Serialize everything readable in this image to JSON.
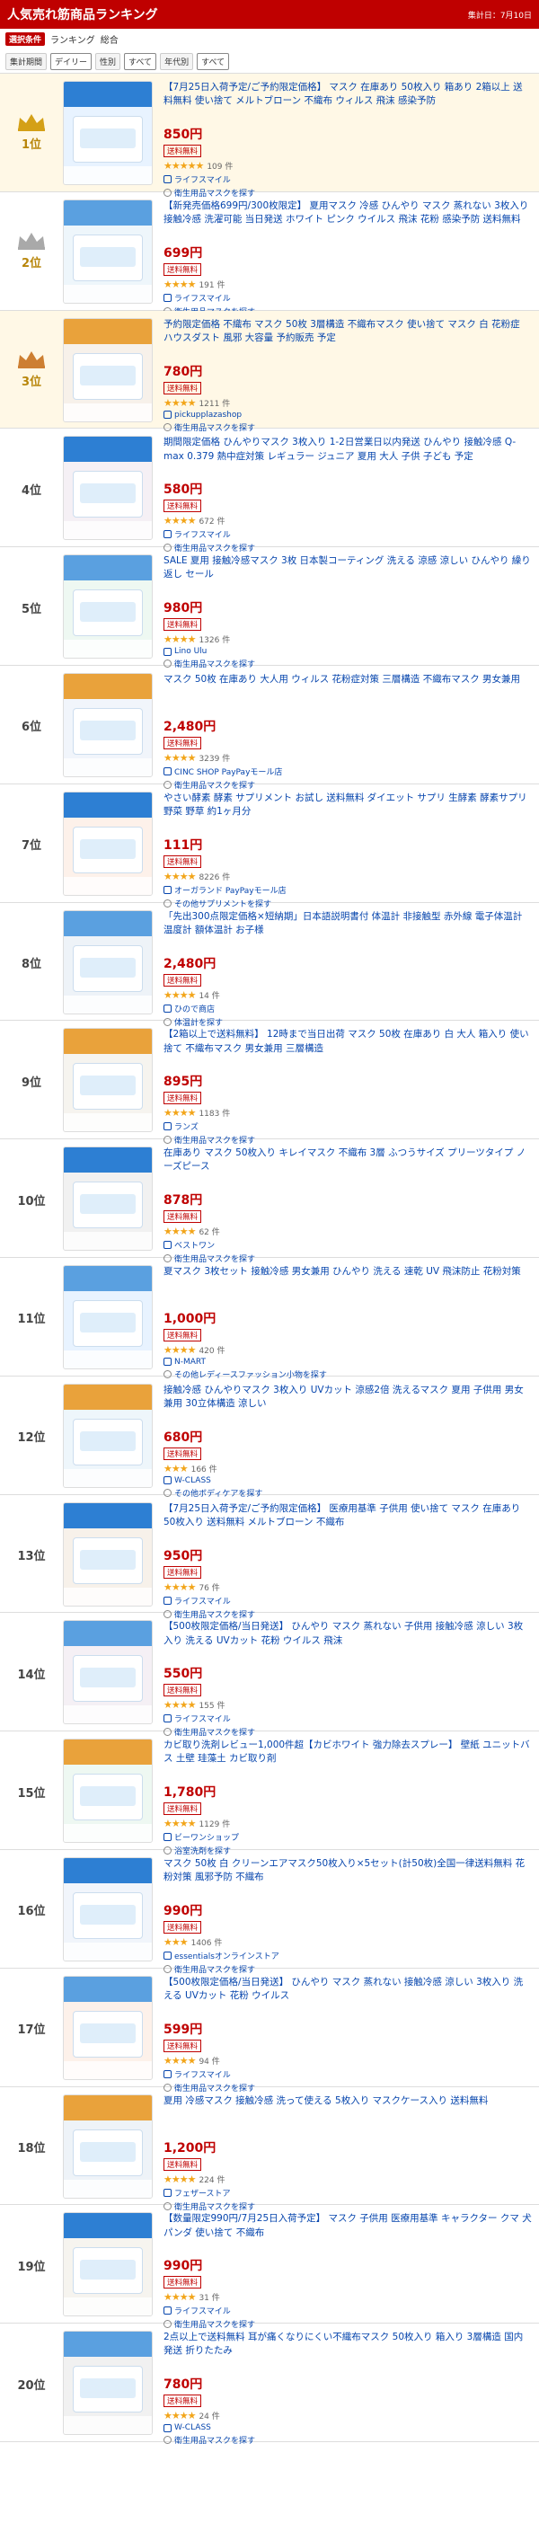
{
  "header": {
    "title": "人気売れ筋商品ランキング",
    "date": "集計日：7月10日"
  },
  "conditions": {
    "tag": "選択条件",
    "label1": "ランキング",
    "label2": "総合",
    "chips": [
      "集計期間",
      "デイリー",
      "性別",
      "すべて",
      "年代別",
      "すべて"
    ]
  },
  "colors": {
    "accent": "#bf0000",
    "gold": "#d4a017",
    "silver": "#a9a9a9",
    "bronze": "#cd7f32",
    "star": "#f2a51a"
  },
  "items": [
    {
      "rank": "1位",
      "title": "【7月25日入荷予定/ご予約限定価格】 マスク 在庫あり 50枚入り 箱あり 2箱以上 送料無料 使い捨て メルトブローン 不織布 ウィルス 飛沫 感染予防",
      "price": "850円",
      "badge": "送料無料",
      "stars": "★★★★★",
      "reviews": "109 件",
      "shop": "ライフスマイル",
      "more": "衛生用品マスクを探す"
    },
    {
      "rank": "2位",
      "title": "【新発売価格699円/300枚限定】 夏用マスク 冷感 ひんやり マスク 蒸れない 3枚入り 接触冷感 洗濯可能 当日発送 ホワイト ピンク ウイルス 飛沫 花粉 感染予防 送料無料",
      "price": "699円",
      "badge": "送料無料",
      "stars": "★★★★",
      "reviews": "191 件",
      "shop": "ライフスマイル",
      "more": "衛生用品マスクを探す"
    },
    {
      "rank": "3位",
      "title": "予約限定価格 不織布 マスク 50枚 3層構造 不織布マスク 使い捨て マスク 白 花粉症 ハウスダスト 風邪 大容量 予約販売 予定",
      "price": "780円",
      "badge": "送料無料",
      "stars": "★★★★",
      "reviews": "1211 件",
      "shop": "pickupplazashop",
      "more": "衛生用品マスクを探す"
    },
    {
      "rank": "4位",
      "title": "期間限定価格 ひんやりマスク 3枚入り 1-2日営業日以内発送 ひんやり 接触冷感 Q-max 0.379 熱中症対策 レギュラー ジュニア 夏用 大人 子供 子ども 予定",
      "price": "580円",
      "badge": "送料無料",
      "stars": "★★★★",
      "reviews": "672 件",
      "shop": "ライフスマイル",
      "more": "衛生用品マスクを探す"
    },
    {
      "rank": "5位",
      "title": "SALE 夏用 接触冷感マスク 3枚 日本製コーティング 洗える 涼感 涼しい ひんやり 繰り返し セール",
      "price": "980円",
      "badge": "送料無料",
      "stars": "★★★★",
      "reviews": "1326 件",
      "shop": "Lino Ulu",
      "more": "衛生用品マスクを探す"
    },
    {
      "rank": "6位",
      "title": "マスク 50枚 在庫あり 大人用 ウィルス 花粉症対策 三層構造 不織布マスク 男女兼用",
      "price": "2,480円",
      "badge": "送料無料",
      "stars": "★★★★",
      "reviews": "3239 件",
      "shop": "CINC SHOP PayPayモール店",
      "more": "衛生用品マスクを探す"
    },
    {
      "rank": "7位",
      "title": "やさい酵素 酵素 サプリメント お試し 送料無料 ダイエット サプリ 生酵素 酵素サプリ 野菜 野草 約1ヶ月分",
      "price": "111円",
      "badge": "送料無料",
      "stars": "★★★★",
      "reviews": "8226 件",
      "shop": "オーガランド PayPayモール店",
      "more": "その他サプリメントを探す"
    },
    {
      "rank": "8位",
      "title": "「先出300点限定価格×短納期」日本語説明書付 体温計 非接触型 赤外線 電子体温計 温度計 額体温計 お子様",
      "price": "2,480円",
      "badge": "送料無料",
      "stars": "★★★★",
      "reviews": "14 件",
      "shop": "ひので商店",
      "more": "体温計を探す"
    },
    {
      "rank": "9位",
      "title": "【2箱以上で送料無料】 12時まで当日出荷 マスク 50枚 在庫あり 白 大人 箱入り 使い捨て 不織布マスク 男女兼用 三層構造",
      "price": "895円",
      "badge": "送料無料",
      "stars": "★★★★",
      "reviews": "1183 件",
      "shop": "ランズ",
      "more": "衛生用品マスクを探す"
    },
    {
      "rank": "10位",
      "title": "在庫あり マスク 50枚入り キレイマスク 不織布 3層 ふつうサイズ プリーツタイプ ノーズピース",
      "price": "878円",
      "badge": "送料無料",
      "stars": "★★★★",
      "reviews": "62 件",
      "shop": "ベストワン",
      "more": "衛生用品マスクを探す"
    },
    {
      "rank": "11位",
      "title": "夏マスク 3枚セット 接触冷感 男女兼用 ひんやり 洗える 速乾 UV 飛沫防止 花粉対策",
      "price": "1,000円",
      "badge": "送料無料",
      "stars": "★★★★",
      "reviews": "420 件",
      "shop": "N-MART",
      "more": "その他レディースファッション小物を探す"
    },
    {
      "rank": "12位",
      "title": "接触冷感 ひんやりマスク 3枚入り UVカット 涼感2倍 洗えるマスク 夏用 子供用 男女兼用 30立体構造 涼しい",
      "price": "680円",
      "badge": "送料無料",
      "stars": "★★★",
      "reviews": "166 件",
      "shop": "W-CLASS",
      "more": "その他ボディケアを探す"
    },
    {
      "rank": "13位",
      "title": "【7月25日入荷予定/ご予約限定価格】 医療用基準 子供用 使い捨て マスク 在庫あり 50枚入り 送料無料 メルトブローン 不織布",
      "price": "950円",
      "badge": "送料無料",
      "stars": "★★★★",
      "reviews": "76 件",
      "shop": "ライフスマイル",
      "more": "衛生用品マスクを探す"
    },
    {
      "rank": "14位",
      "title": "【500枚限定価格/当日発送】 ひんやり マスク 蒸れない 子供用 接触冷感 涼しい 3枚入り 洗える UVカット 花粉 ウイルス 飛沫",
      "price": "550円",
      "badge": "送料無料",
      "stars": "★★★★",
      "reviews": "155 件",
      "shop": "ライフスマイル",
      "more": "衛生用品マスクを探す"
    },
    {
      "rank": "15位",
      "title": "カビ取り洗剤レビュー1,000件超【カビホワイト 強力除去スプレー】 壁紙 ユニットバス 土壁 珪藻土 カビ取り剤",
      "price": "1,780円",
      "badge": "送料無料",
      "stars": "★★★★",
      "reviews": "1129 件",
      "shop": "ビーワンショップ",
      "more": "浴室洗剤を探す"
    },
    {
      "rank": "16位",
      "title": "マスク 50枚 白 クリーンエアマスク50枚入り×5セット(計50枚)全国一律送料無料 花粉対策 風邪予防 不織布",
      "price": "990円",
      "badge": "送料無料",
      "stars": "★★★",
      "reviews": "1406 件",
      "shop": "essentialsオンラインストア",
      "more": "衛生用品マスクを探す"
    },
    {
      "rank": "17位",
      "title": "【500枚限定価格/当日発送】 ひんやり マスク 蒸れない 接触冷感 涼しい 3枚入り 洗える UVカット 花粉 ウイルス",
      "price": "599円",
      "badge": "送料無料",
      "stars": "★★★★",
      "reviews": "94 件",
      "shop": "ライフスマイル",
      "more": "衛生用品マスクを探す"
    },
    {
      "rank": "18位",
      "title": "夏用 冷感マスク 接触冷感 洗って使える 5枚入り マスクケース入り 送料無料",
      "price": "1,200円",
      "badge": "送料無料",
      "stars": "★★★★",
      "reviews": "224 件",
      "shop": "フェザーストア",
      "more": "衛生用品マスクを探す"
    },
    {
      "rank": "19位",
      "title": "【数量限定990円/7月25日入荷予定】 マスク 子供用 医療用基準 キャラクター クマ 犬 パンダ 使い捨て 不織布",
      "price": "990円",
      "badge": "送料無料",
      "stars": "★★★★",
      "reviews": "31 件",
      "shop": "ライフスマイル",
      "more": "衛生用品マスクを探す"
    },
    {
      "rank": "20位",
      "title": "2点以上で送料無料 耳が痛くなりにくい不織布マスク 50枚入り 箱入り 3層構造 国内発送 折りたたみ",
      "price": "780円",
      "badge": "送料無料",
      "stars": "★★★★",
      "reviews": "24 件",
      "shop": "W-CLASS",
      "more": "衛生用品マスクを探す"
    }
  ]
}
